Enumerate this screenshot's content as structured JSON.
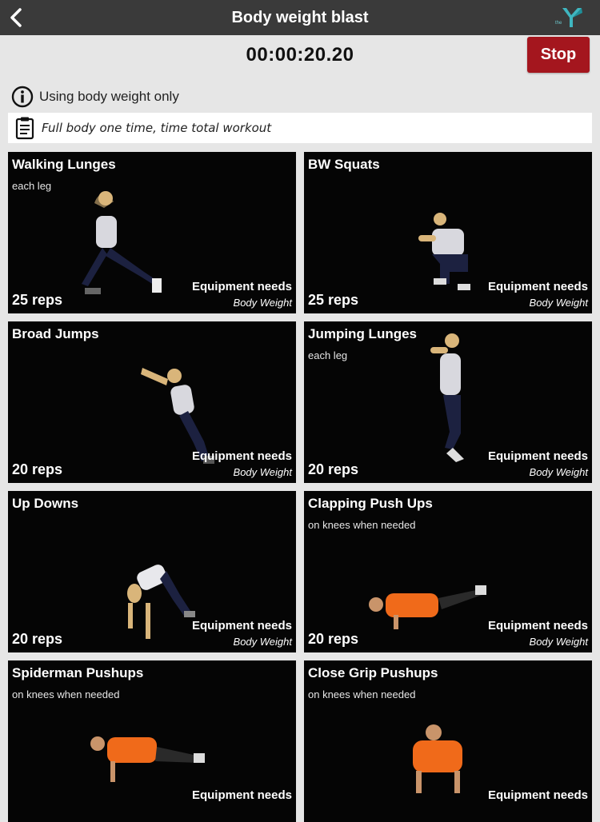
{
  "header": {
    "title": "Body weight blast",
    "back_icon": "chevron-left-icon",
    "logo_icon": "ymca-logo-icon",
    "logo_text": "the",
    "bar_color": "#3a3a3a"
  },
  "timer": {
    "value": "00:00:20.20",
    "stop_label": "Stop",
    "stop_color": "#a4161e"
  },
  "info": {
    "icon": "info-icon",
    "text": "Using body weight only"
  },
  "note": {
    "icon": "clipboard-icon",
    "text": "Full body one time, time total workout"
  },
  "exercises": [
    {
      "name": "Walking Lunges",
      "sub": "each leg",
      "reps": "25 reps",
      "equip_label": "Equipment needs",
      "equip_value": "Body Weight"
    },
    {
      "name": "BW Squats",
      "sub": "",
      "reps": "25 reps",
      "equip_label": "Equipment needs",
      "equip_value": "Body Weight"
    },
    {
      "name": "Broad Jumps",
      "sub": "",
      "reps": "20 reps",
      "equip_label": "Equipment needs",
      "equip_value": "Body Weight"
    },
    {
      "name": "Jumping Lunges",
      "sub": "each leg",
      "reps": "20 reps",
      "equip_label": "Equipment needs",
      "equip_value": "Body Weight"
    },
    {
      "name": "Up Downs",
      "sub": "",
      "reps": "20 reps",
      "equip_label": "Equipment needs",
      "equip_value": "Body Weight"
    },
    {
      "name": "Clapping Push Ups",
      "sub": "on knees when needed",
      "reps": "20 reps",
      "equip_label": "Equipment needs",
      "equip_value": "Body Weight"
    },
    {
      "name": "Spiderman Pushups",
      "sub": "on knees when needed",
      "reps": "",
      "equip_label": "Equipment needs",
      "equip_value": ""
    },
    {
      "name": "Close Grip Pushups",
      "sub": "on knees when needed",
      "reps": "",
      "equip_label": "Equipment needs",
      "equip_value": ""
    }
  ]
}
